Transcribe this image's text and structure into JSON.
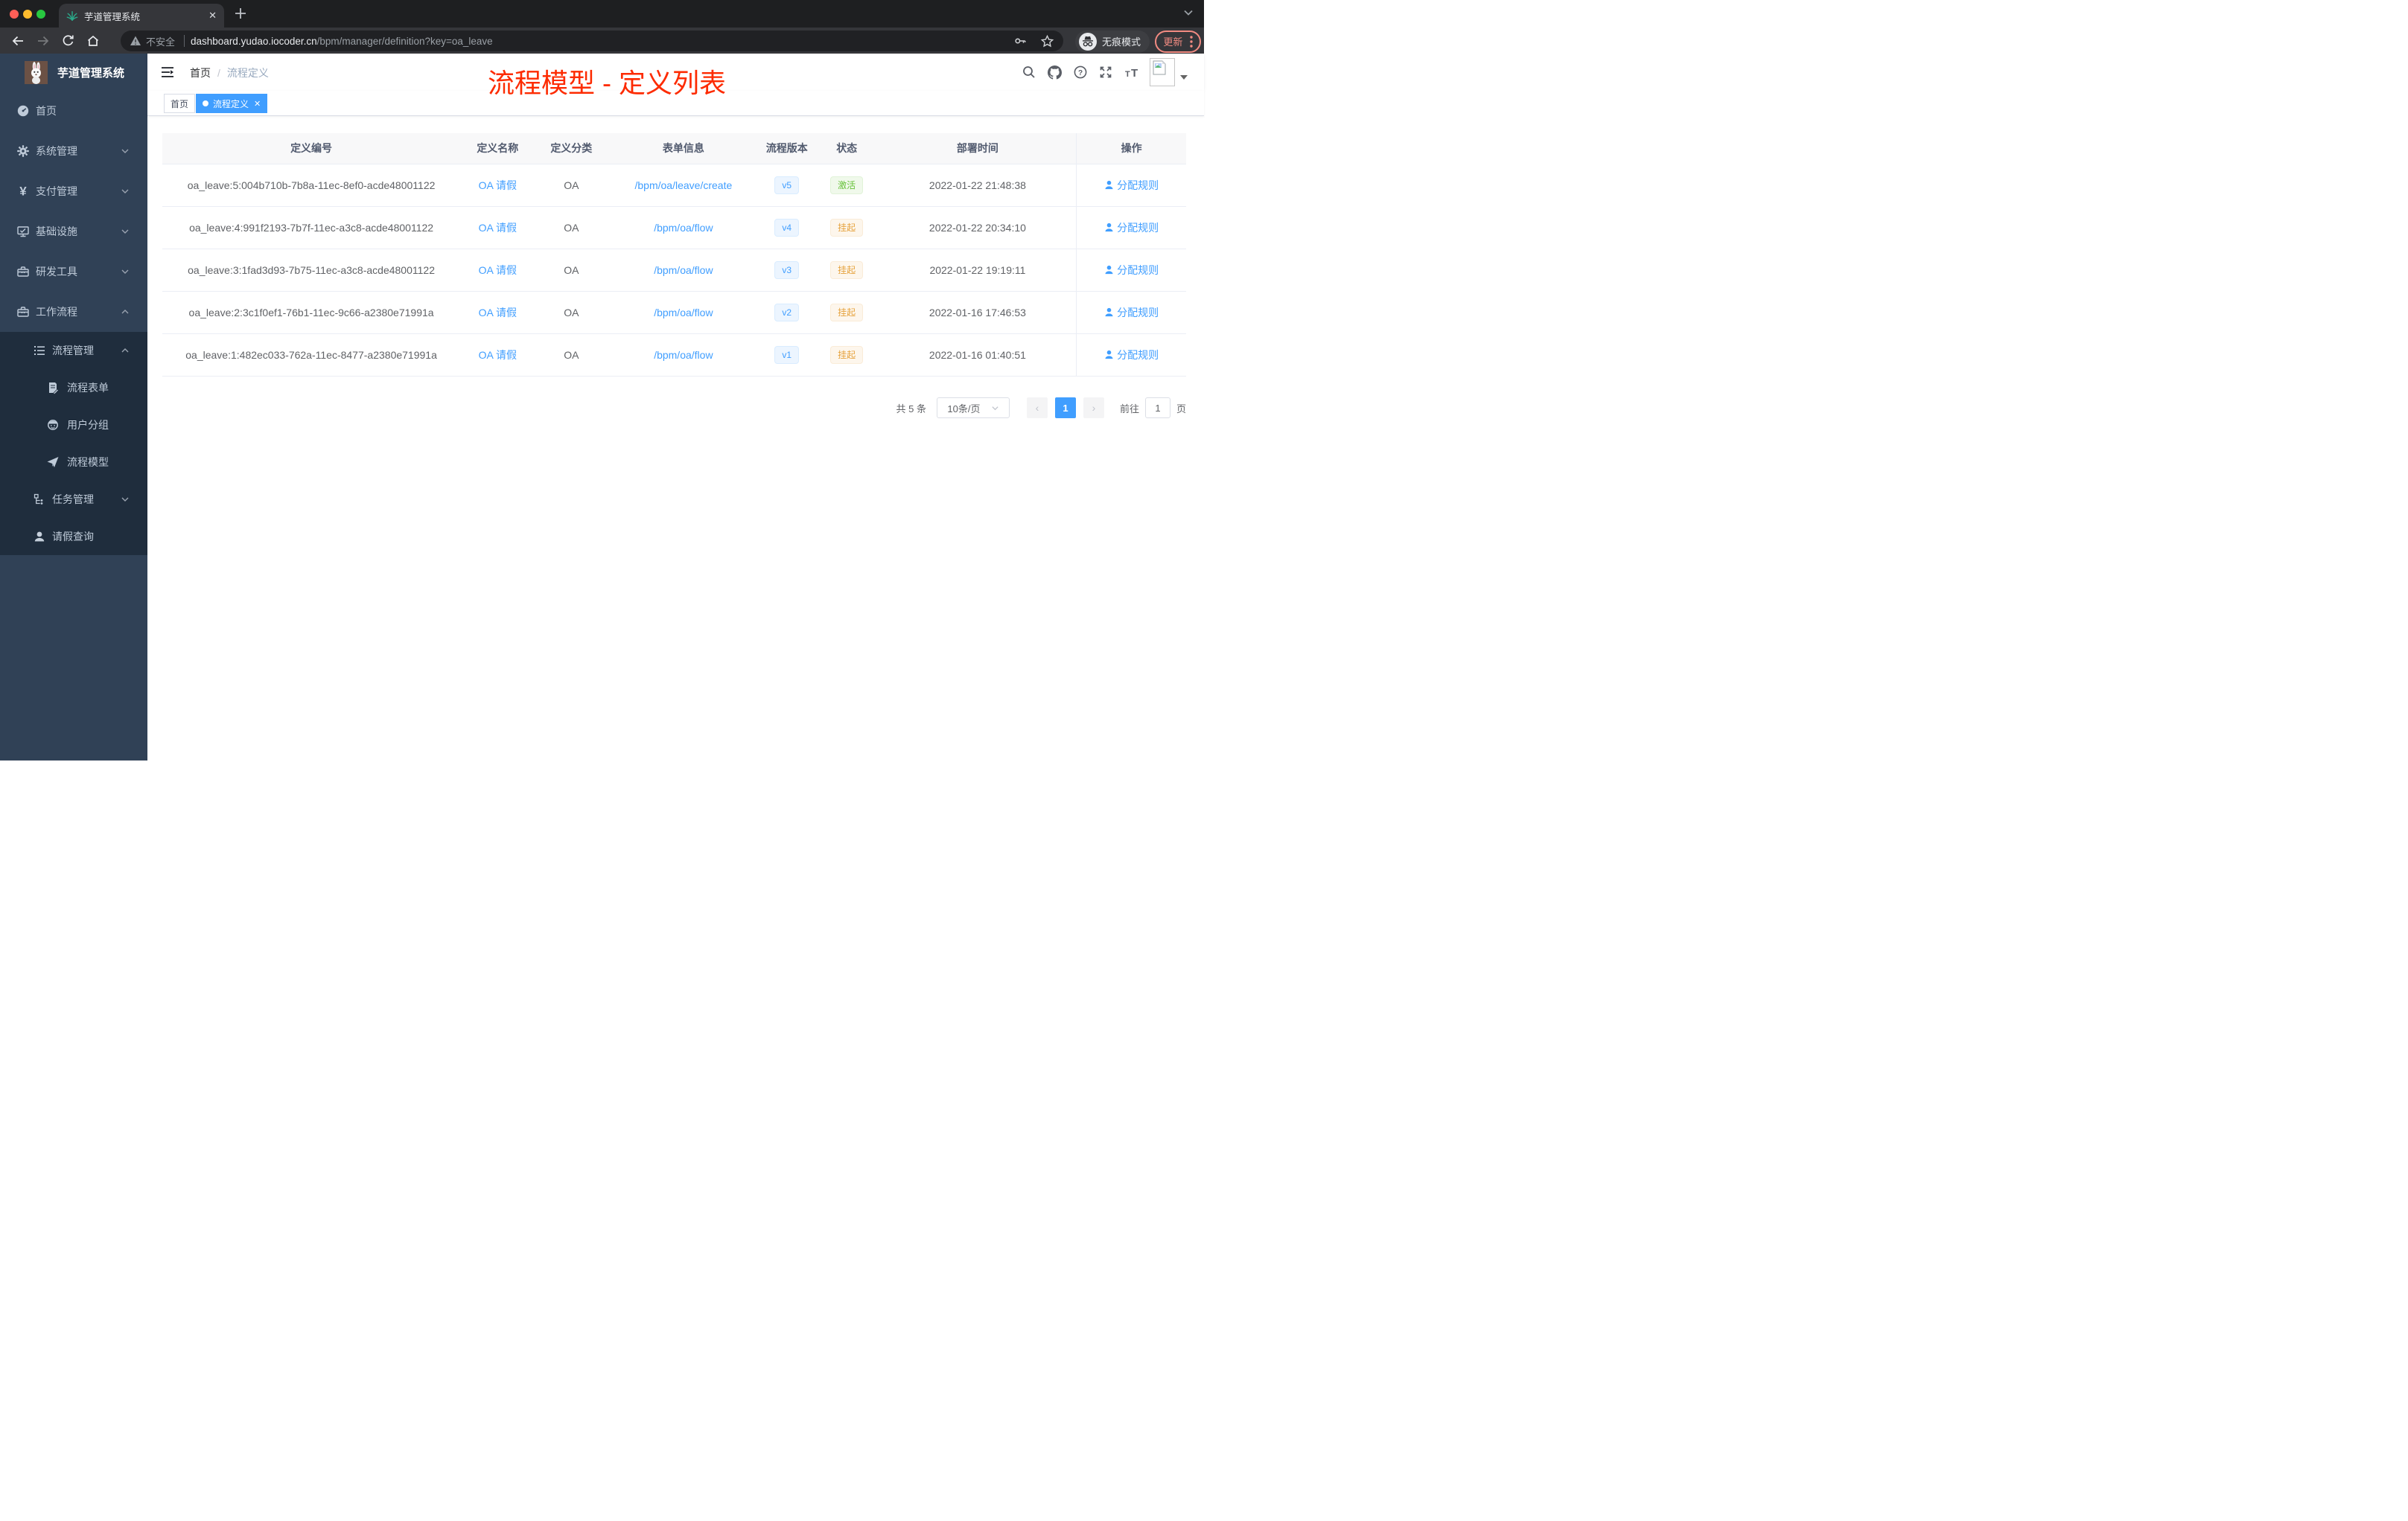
{
  "colors": {
    "accent": "#409eff",
    "success": "#67c23a",
    "warning": "#e6a23c",
    "annotation": "#fd2b01"
  },
  "annotation": {
    "title": "流程模型 - 定义列表"
  },
  "browser": {
    "tab_title": "芋道管理系统",
    "security_label": "不安全",
    "url_domain": "dashboard.yudao.iocoder.cn",
    "url_path": "/bpm/manager/definition?key=oa_leave",
    "incognito_label": "无痕模式",
    "update_label": "更新"
  },
  "sidebar": {
    "title": "芋道管理系统",
    "items": [
      {
        "label": "首页"
      },
      {
        "label": "系统管理"
      },
      {
        "label": "支付管理"
      },
      {
        "label": "基础设施"
      },
      {
        "label": "研发工具"
      },
      {
        "label": "工作流程"
      },
      {
        "label": "流程管理"
      },
      {
        "label": "流程表单"
      },
      {
        "label": "用户分组"
      },
      {
        "label": "流程模型"
      },
      {
        "label": "任务管理"
      },
      {
        "label": "请假查询"
      }
    ]
  },
  "header": {
    "breadcrumb": {
      "home": "首页",
      "current": "流程定义"
    },
    "tags": {
      "home": "首页",
      "active": "流程定义"
    }
  },
  "table": {
    "columns": [
      "定义编号",
      "定义名称",
      "定义分类",
      "表单信息",
      "流程版本",
      "状态",
      "部署时间",
      "操作"
    ],
    "rows": [
      {
        "id": "oa_leave:5:004b710b-7b8a-11ec-8ef0-acde48001122",
        "name": "OA 请假",
        "category": "OA",
        "form": "/bpm/oa/leave/create",
        "version": "v5",
        "status": {
          "label": "激活",
          "type": "success"
        },
        "deploy_time": "2022-01-22 21:48:38",
        "action": "分配规则"
      },
      {
        "id": "oa_leave:4:991f2193-7b7f-11ec-a3c8-acde48001122",
        "name": "OA 请假",
        "category": "OA",
        "form": "/bpm/oa/flow",
        "version": "v4",
        "status": {
          "label": "挂起",
          "type": "warning"
        },
        "deploy_time": "2022-01-22 20:34:10",
        "action": "分配规则"
      },
      {
        "id": "oa_leave:3:1fad3d93-7b75-11ec-a3c8-acde48001122",
        "name": "OA 请假",
        "category": "OA",
        "form": "/bpm/oa/flow",
        "version": "v3",
        "status": {
          "label": "挂起",
          "type": "warning"
        },
        "deploy_time": "2022-01-22 19:19:11",
        "action": "分配规则"
      },
      {
        "id": "oa_leave:2:3c1f0ef1-76b1-11ec-9c66-a2380e71991a",
        "name": "OA 请假",
        "category": "OA",
        "form": "/bpm/oa/flow",
        "version": "v2",
        "status": {
          "label": "挂起",
          "type": "warning"
        },
        "deploy_time": "2022-01-16 17:46:53",
        "action": "分配规则"
      },
      {
        "id": "oa_leave:1:482ec033-762a-11ec-8477-a2380e71991a",
        "name": "OA 请假",
        "category": "OA",
        "form": "/bpm/oa/flow",
        "version": "v1",
        "status": {
          "label": "挂起",
          "type": "warning"
        },
        "deploy_time": "2022-01-16 01:40:51",
        "action": "分配规则"
      }
    ]
  },
  "pagination": {
    "total": "共 5 条",
    "page_size": "10条/页",
    "current_page": "1",
    "goto_label": "前往",
    "goto_value": "1",
    "page_unit": "页"
  }
}
